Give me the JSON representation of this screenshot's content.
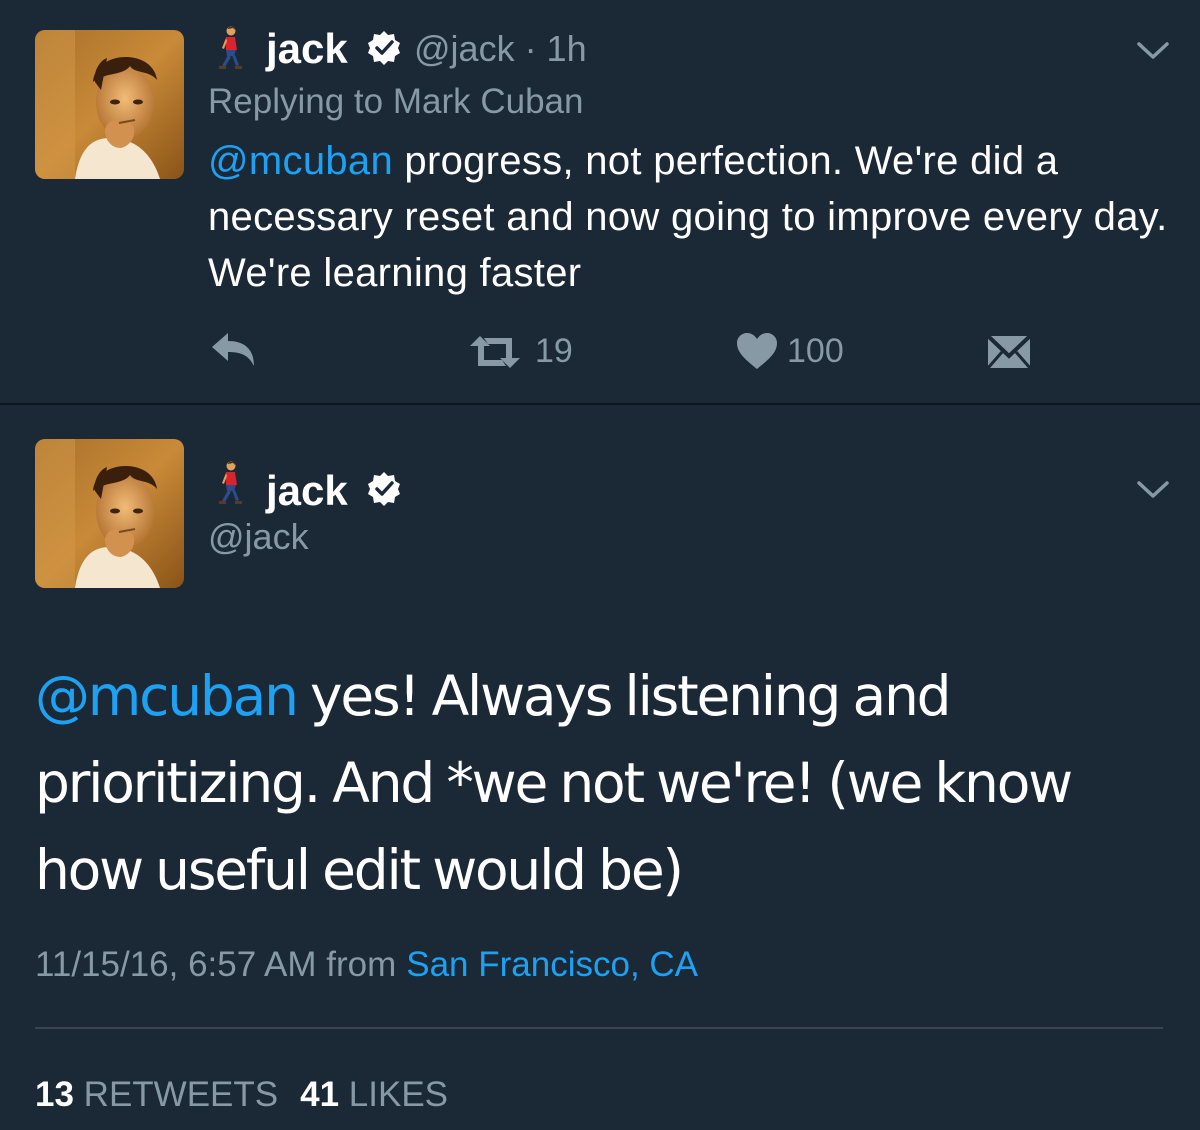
{
  "reply_tweet": {
    "name": "jack",
    "handle_time": "@jack · 1h",
    "replying_to": "Replying to Mark Cuban",
    "mention": "@mcuban",
    "text": " progress, not perfection. We're did a necessary reset and now going to improve every day. We're learning faster",
    "retweets": "19",
    "likes": "100"
  },
  "main_tweet": {
    "name": "jack",
    "handle": "@jack",
    "mention": "@mcuban",
    "text": " yes! Always listening and prioritizing. And *we not we're! (we know how useful edit would be)",
    "timestamp": "11/15/16, 6:57 AM from",
    "location": "San Francisco, CA",
    "retweet_count": "13",
    "retweet_label": "RETWEETS",
    "like_count": "41",
    "like_label": "LIKES"
  },
  "colors": {
    "background": "#1b2836",
    "accent": "#1da1f2",
    "secondary_text": "#8899a6"
  },
  "icons": [
    "walking-person-emoji",
    "verified-badge-icon",
    "chevron-down-icon",
    "reply-icon",
    "retweet-icon",
    "heart-icon",
    "direct-message-icon"
  ]
}
